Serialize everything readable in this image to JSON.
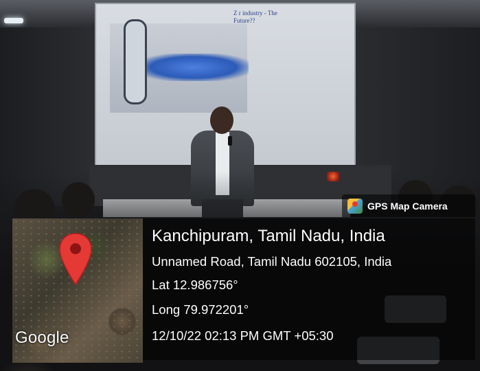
{
  "slide": {
    "title": "Z r industry - The Future??"
  },
  "watermark": {
    "app_name": "GPS Map Camera",
    "map_provider": "Google",
    "location": "Kanchipuram, Tamil Nadu, India",
    "address": "Unnamed Road, Tamil Nadu 602105, India",
    "latitude": "Lat 12.986756°",
    "longitude": "Long 79.972201°",
    "timestamp": "12/10/22 02:13 PM GMT +05:30"
  },
  "colors": {
    "pin": "#e53935",
    "panel_bg": "rgba(0,0,0,0.55)",
    "text": "#ffffff"
  },
  "icons": [
    "location-pin-icon",
    "gps-map-camera-icon"
  ]
}
